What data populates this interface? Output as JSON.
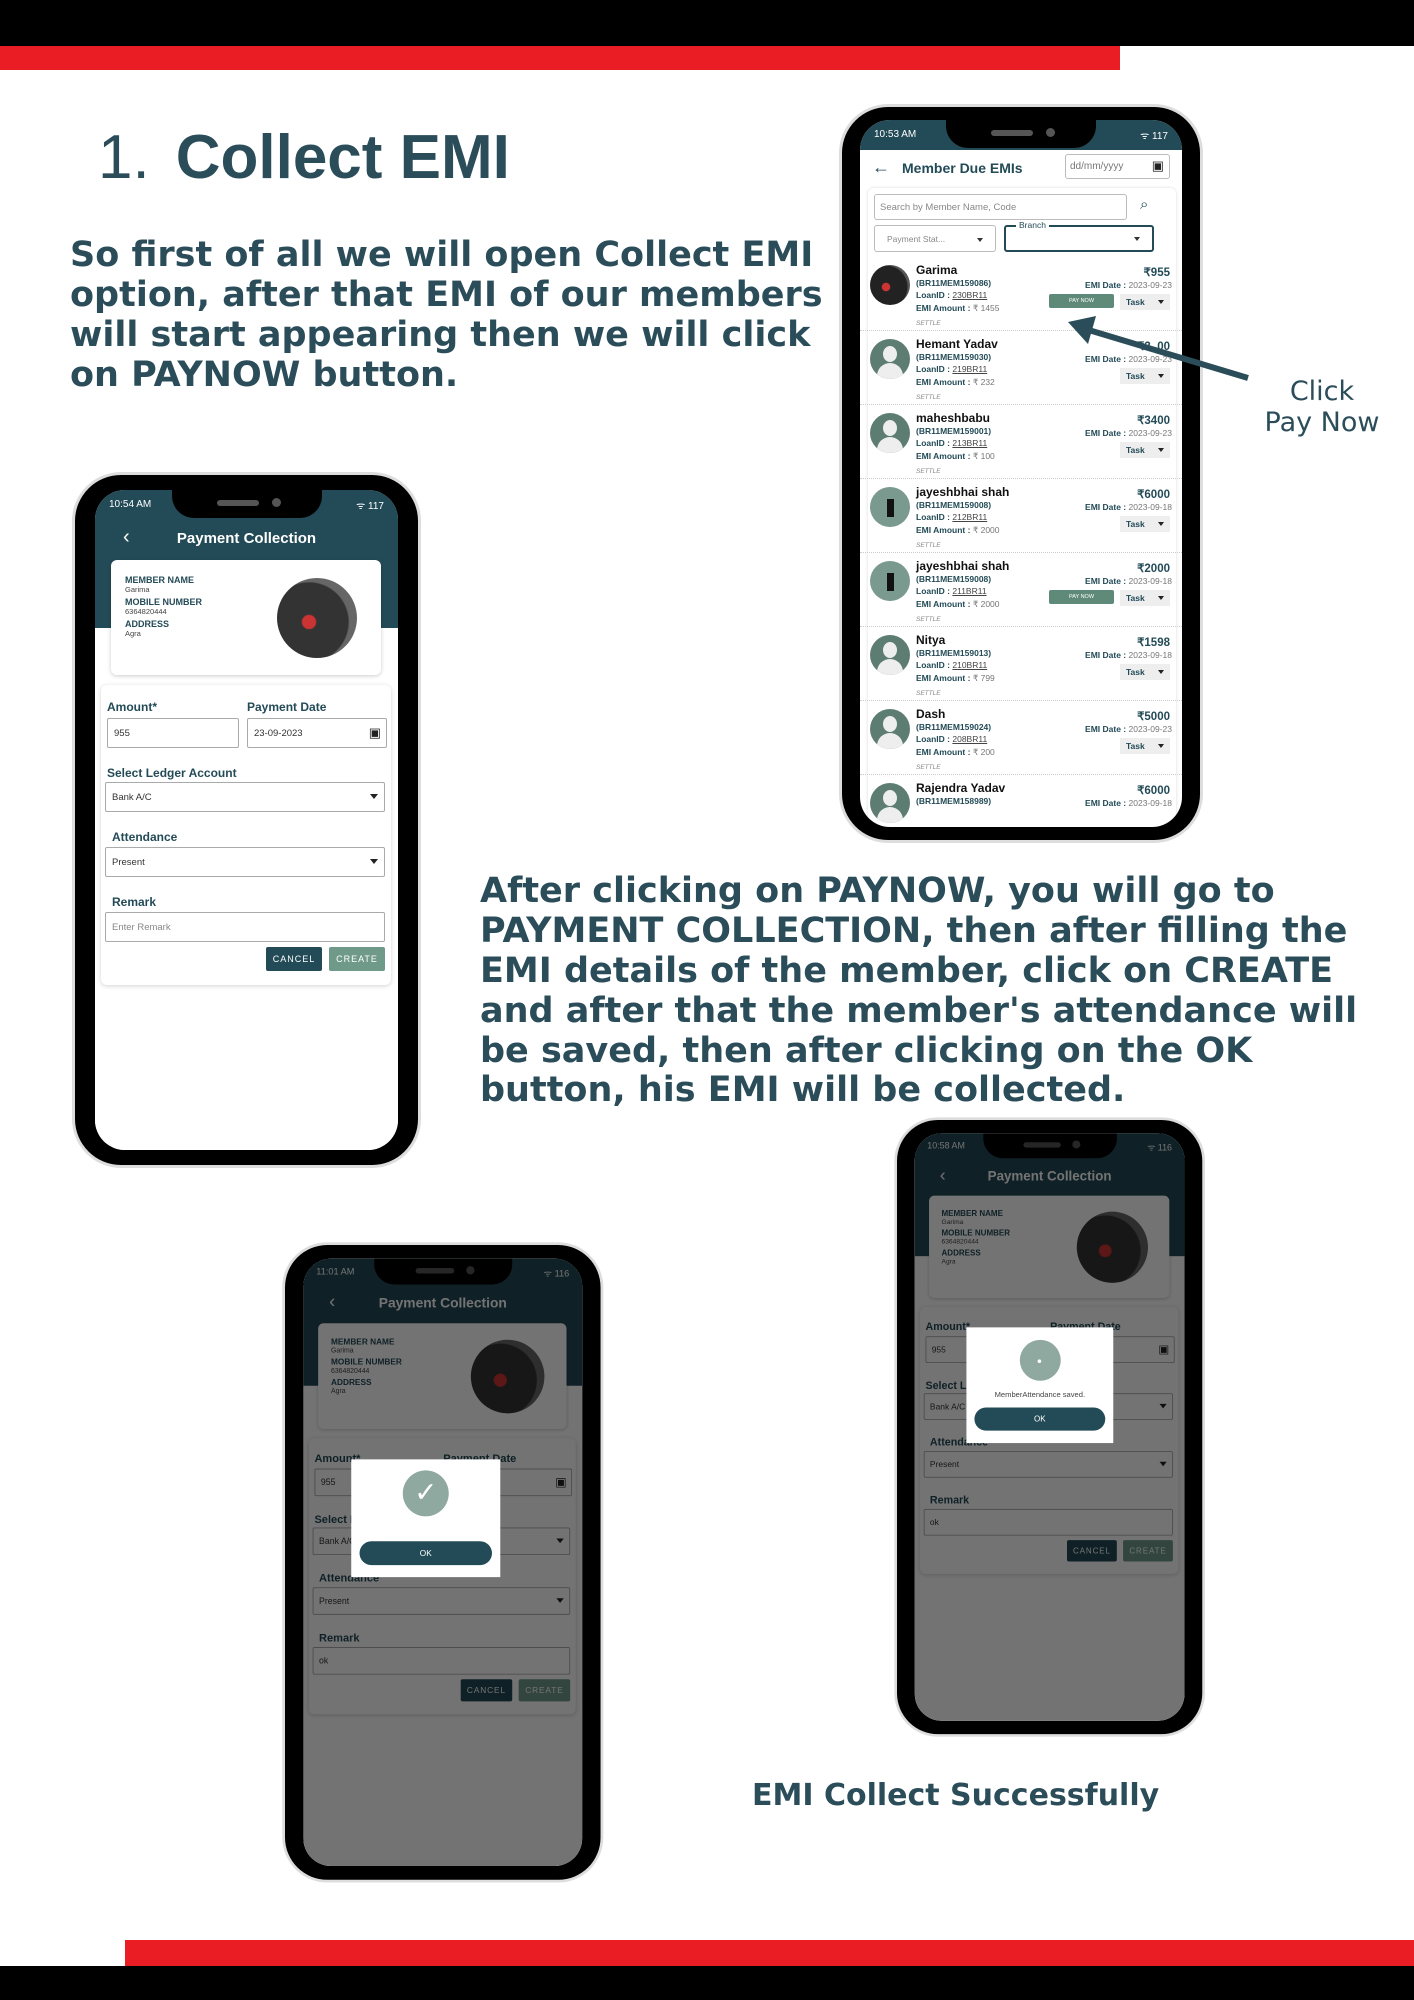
{
  "heading": {
    "number": "1.",
    "title": "Collect EMI"
  },
  "intro": "So first of all we will open Collect EMI option, after that EMI of our members will start appearing then we will click on PAYNOW button.",
  "annotation": "Click Pay Now",
  "instructions": "After clicking on PAYNOW, you will go to PAYMENT COLLECTION, then after filling the EMI details of the member, click on CREATE and after that the member's attendance will be saved, then after clicking on the OK button, his EMI will be collected.",
  "success_caption": "EMI Collect Successfully",
  "colors": {
    "brand_teal": "#234b57",
    "text": "#2b4d5a",
    "accent_red": "#ea1c24",
    "pay_now": "#5f8a7a"
  },
  "member_list": {
    "time": "10:53 AM",
    "battery": "117",
    "title": "Member Due EMIs",
    "date_placeholder": "dd/mm/yyyy",
    "search_placeholder": "Search by Member Name, Code",
    "payment_status_placeholder": "Payment Stat...",
    "branch_label": "Branch",
    "labels": {
      "loan": "LoanID :",
      "emi_amount": "EMI Amount :",
      "emi_date": "EMI Date :",
      "settle": "SETTLE",
      "pay_now": "PAY NOW",
      "task": "Task"
    },
    "members": [
      {
        "name": "Garima",
        "code": "(BR11MEM159086)",
        "loan": "230BR11",
        "emi": "₹ 1455",
        "amount": "₹955",
        "date": "2023-09-23",
        "pay_now": true,
        "avatar": "photo"
      },
      {
        "name": "Hemant Yadav",
        "code": "(BR11MEM159030)",
        "loan": "219BR11",
        "emi": "₹ 232",
        "amount": "₹3..00",
        "date": "2023-09-23",
        "pay_now": false,
        "avatar": "default"
      },
      {
        "name": "maheshbabu",
        "code": "(BR11MEM159001)",
        "loan": "213BR11",
        "emi": "₹ 100",
        "amount": "₹3400",
        "date": "2023-09-23",
        "pay_now": false,
        "avatar": "default"
      },
      {
        "name": "jayeshbhai shah",
        "code": "(BR11MEM159008)",
        "loan": "212BR11",
        "emi": "₹ 2000",
        "amount": "₹6000",
        "date": "2023-09-18",
        "pay_now": false,
        "avatar": "photo2"
      },
      {
        "name": "jayeshbhai shah",
        "code": "(BR11MEM159008)",
        "loan": "211BR11",
        "emi": "₹ 2000",
        "amount": "₹2000",
        "date": "2023-09-18",
        "pay_now": true,
        "avatar": "photo2"
      },
      {
        "name": "Nitya",
        "code": "(BR11MEM159013)",
        "loan": "210BR11",
        "emi": "₹ 799",
        "amount": "₹1598",
        "date": "2023-09-18",
        "pay_now": false,
        "avatar": "default"
      },
      {
        "name": "Dash",
        "code": "(BR11MEM159024)",
        "loan": "208BR11",
        "emi": "₹ 200",
        "amount": "₹5000",
        "date": "2023-09-23",
        "pay_now": false,
        "avatar": "default"
      },
      {
        "name": "Rajendra Yadav",
        "code": "(BR11MEM158989)",
        "loan": "",
        "emi": "",
        "amount": "₹6000",
        "date": "2023-09-18",
        "pay_now": false,
        "avatar": "default"
      }
    ]
  },
  "payment_form": {
    "title": "Payment Collection",
    "member_name_label": "MEMBER NAME",
    "member_name": "Garima",
    "mobile_label": "MOBILE NUMBER",
    "mobile": "6364820444",
    "address_label": "ADDRESS",
    "address": "Agra",
    "amount_label": "Amount*",
    "amount": "955",
    "date_label": "Payment Date",
    "date": "23-09-2023",
    "ledger_label": "Select Ledger Account",
    "ledger": "Bank A/C",
    "attendance_label": "Attendance",
    "attendance": "Present",
    "remark_label": "Remark",
    "remark_placeholder": "Enter Remark",
    "cancel": "CANCEL",
    "create": "CREATE"
  },
  "screens": [
    {
      "time": "10:54 AM",
      "battery": "117",
      "remark": ""
    },
    {
      "time": "10:58 AM",
      "battery": "116",
      "remark": "ok",
      "dialog_message": "MemberAttendance saved.",
      "dialog_ok": "OK"
    },
    {
      "time": "11:01 AM",
      "battery": "116",
      "remark": "ok",
      "dialog_ok": "OK",
      "dialog_icon": "check-circle"
    }
  ]
}
